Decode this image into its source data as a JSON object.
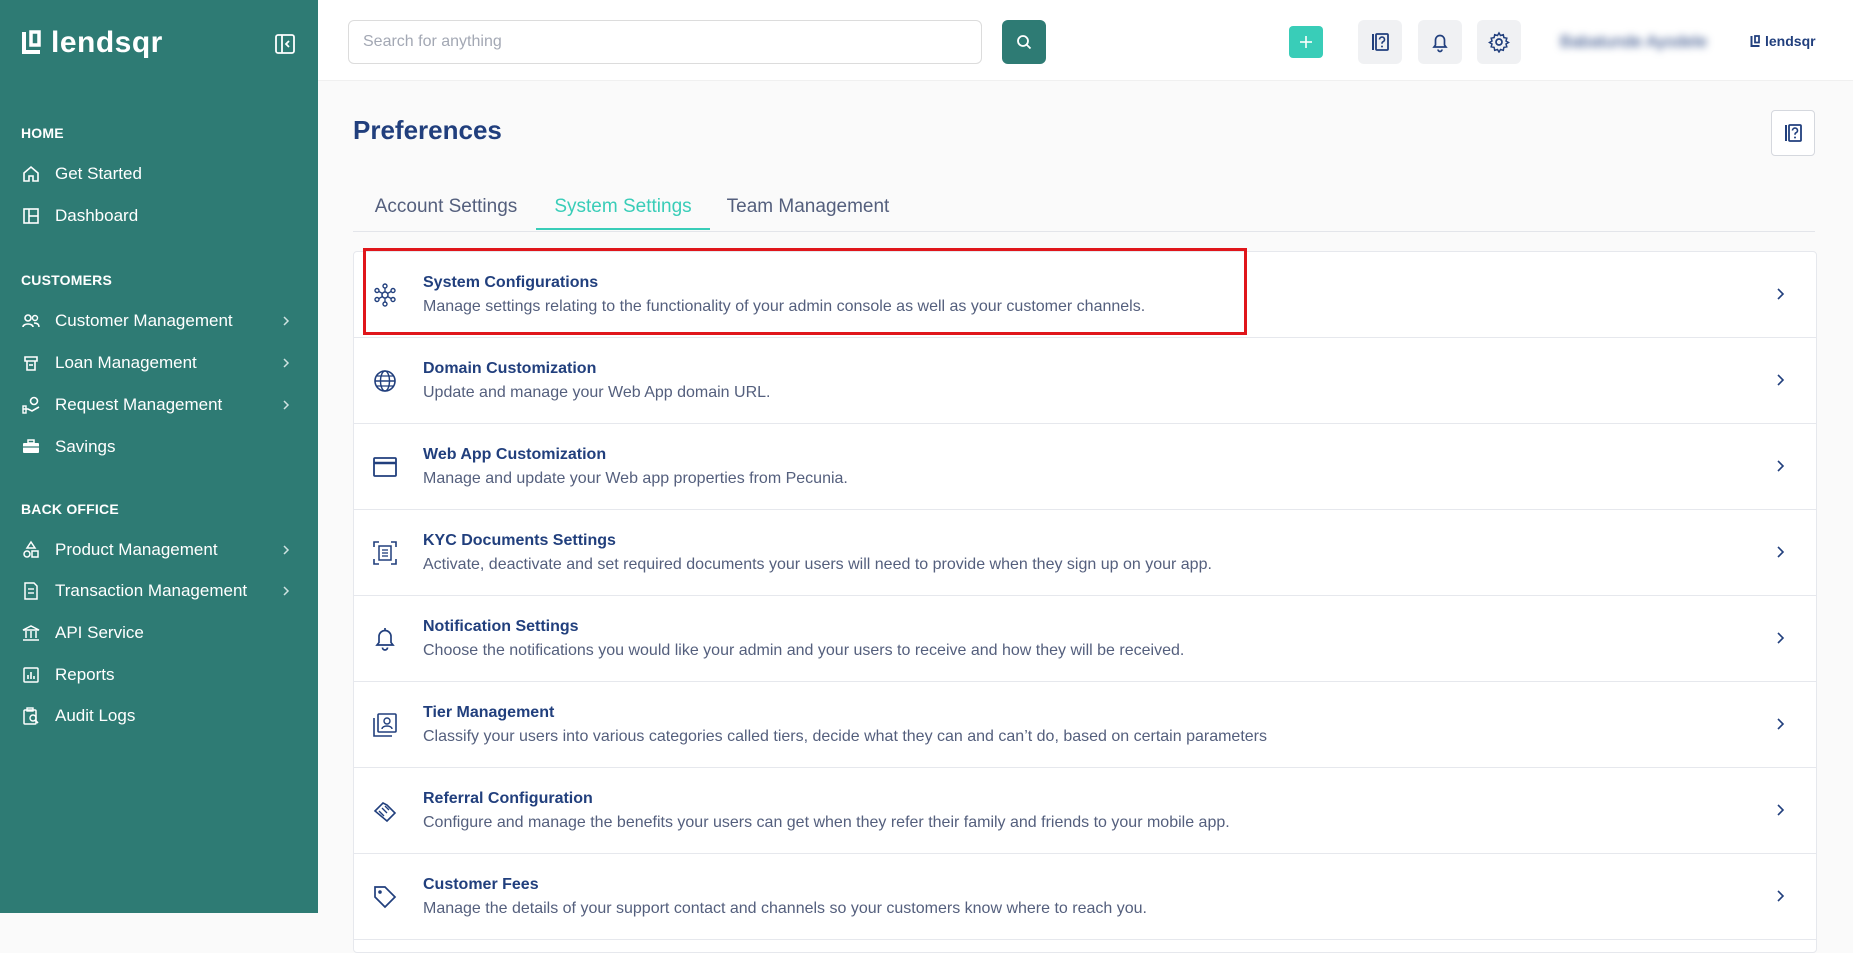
{
  "brand": {
    "name": "lendsqr",
    "primary": "#2e7b74",
    "accent": "#39cdb8",
    "highlight": "#e0161b"
  },
  "sidebar": {
    "sections": [
      {
        "title": "HOME",
        "items": [
          {
            "label": "Get Started",
            "icon": "home-icon",
            "expandable": false
          },
          {
            "label": "Dashboard",
            "icon": "dashboard-icon",
            "expandable": false
          }
        ]
      },
      {
        "title": "CUSTOMERS",
        "items": [
          {
            "label": "Customer Management",
            "icon": "users-icon",
            "expandable": true
          },
          {
            "label": "Loan Management",
            "icon": "loan-icon",
            "expandable": true
          },
          {
            "label": "Request Management",
            "icon": "request-icon",
            "expandable": true
          },
          {
            "label": "Savings",
            "icon": "savings-icon",
            "expandable": false
          }
        ]
      },
      {
        "title": "BACK OFFICE",
        "items": [
          {
            "label": "Product Management",
            "icon": "product-icon",
            "expandable": true
          },
          {
            "label": "Transaction Management",
            "icon": "transaction-icon",
            "expandable": true
          },
          {
            "label": "API Service",
            "icon": "bank-icon",
            "expandable": false
          },
          {
            "label": "Reports",
            "icon": "reports-icon",
            "expandable": false
          },
          {
            "label": "Audit Logs",
            "icon": "audit-icon",
            "expandable": false
          }
        ]
      }
    ]
  },
  "topbar": {
    "search_placeholder": "Search for anything",
    "user_name": "Babatunde Ayodele",
    "org_logo_text": "lendsqr"
  },
  "main": {
    "title": "Preferences",
    "tabs": [
      {
        "label": "Account Settings",
        "active": false
      },
      {
        "label": "System Settings",
        "active": true
      },
      {
        "label": "Team Management",
        "active": false
      }
    ],
    "settings": [
      {
        "title": "System Configurations",
        "description": "Manage settings relating to the functionality of your admin console as well as your customer channels.",
        "icon": "network-icon"
      },
      {
        "title": "Domain Customization",
        "description": "Update and manage your Web App domain URL.",
        "icon": "globe-icon"
      },
      {
        "title": "Web App Customization",
        "description": "Manage and update your Web app properties from Pecunia.",
        "icon": "browser-window-icon"
      },
      {
        "title": "KYC Documents Settings",
        "description": "Activate, deactivate and set required documents your users will need to provide when they sign up on your app.",
        "icon": "document-scan-icon"
      },
      {
        "title": "Notification Settings",
        "description": "Choose the notifications you would like your admin and your users to receive and how they will be received.",
        "icon": "bell-icon"
      },
      {
        "title": "Tier Management",
        "description": "Classify your users into various categories called tiers, decide what they can and can’t do, based on certain parameters",
        "icon": "tier-icon"
      },
      {
        "title": "Referral Configuration",
        "description": "Configure and manage the benefits your users can get when they refer their family and friends to your mobile app.",
        "icon": "handshake-icon"
      },
      {
        "title": "Customer Fees",
        "description": "Manage the details of your support contact and channels so your customers know where to reach you.",
        "icon": "tag-icon"
      }
    ]
  }
}
